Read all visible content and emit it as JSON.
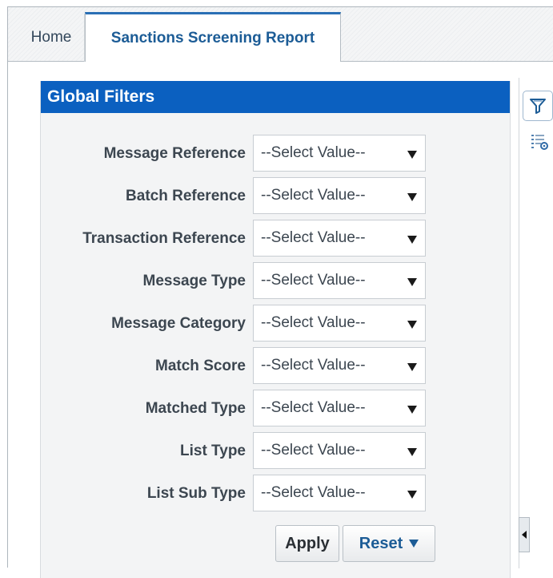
{
  "tabs": {
    "home": "Home",
    "active": "Sanctions Screening Report"
  },
  "panel": {
    "title": "Global Filters"
  },
  "filters": [
    {
      "label": "Message Reference",
      "value": "--Select Value--"
    },
    {
      "label": "Batch Reference",
      "value": "--Select Value--"
    },
    {
      "label": "Transaction Reference",
      "value": "--Select Value--"
    },
    {
      "label": "Message Type",
      "value": "--Select Value--"
    },
    {
      "label": "Message Category",
      "value": "--Select Value--"
    },
    {
      "label": "Match Score",
      "value": "--Select Value--"
    },
    {
      "label": "Matched Type",
      "value": "--Select Value--"
    },
    {
      "label": "List Type",
      "value": "--Select Value--"
    },
    {
      "label": "List Sub Type",
      "value": "--Select Value--"
    }
  ],
  "actions": {
    "apply": "Apply",
    "reset": "Reset"
  },
  "icons": {
    "filter": "filter-icon",
    "list": "list-settings-icon",
    "collapse": "collapse-left-icon",
    "dropdown": "chevron-down-icon"
  },
  "colors": {
    "header_blue": "#0b60c0",
    "active_tab_text": "#1c5c96"
  }
}
